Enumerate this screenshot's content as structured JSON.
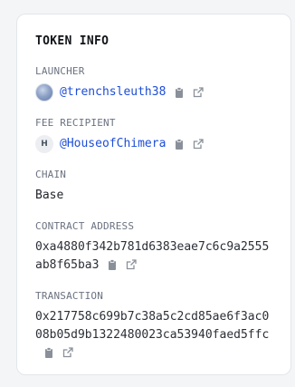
{
  "card": {
    "title": "TOKEN INFO"
  },
  "launcher": {
    "label": "LAUNCHER",
    "handle": "@trenchsleuth38",
    "avatar": "profile-image"
  },
  "fee_recipient": {
    "label": "FEE RECIPIENT",
    "handle": "@HouseofChimera",
    "avatar_letter": "H"
  },
  "chain": {
    "label": "CHAIN",
    "value": "Base"
  },
  "contract_address": {
    "label": "CONTRACT ADDRESS",
    "value": "0xa4880f342b781d6383eae7c6c9a2555ab8f65ba3"
  },
  "transaction": {
    "label": "TRANSACTION",
    "value": "0x217758c699b7c38a5c2cd85ae6f3ac008b05d9b1322480023ca53940faed5ffc"
  },
  "icons": {
    "copy": "clipboard-icon",
    "external": "external-link-icon"
  },
  "colors": {
    "link": "#1d4ed8",
    "icon": "#8a9099",
    "label": "#6b7280"
  }
}
